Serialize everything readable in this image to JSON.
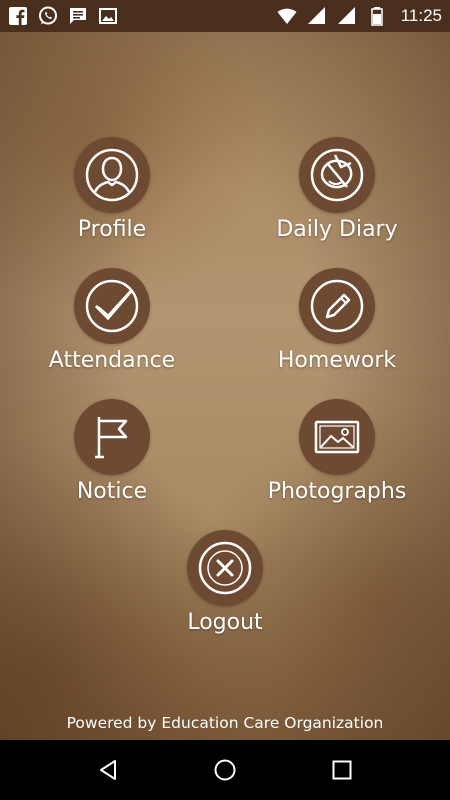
{
  "status_bar": {
    "time": "11:25",
    "left_icons": [
      "facebook-icon",
      "whatsapp-icon",
      "message-icon",
      "image-icon"
    ],
    "right_icons": [
      "wifi-icon",
      "signal-icon",
      "signal-icon",
      "battery-icon"
    ]
  },
  "menu": {
    "profile": {
      "label": "Profile",
      "icon": "user-icon"
    },
    "daily_diary": {
      "label": "Daily Diary",
      "icon": "diary-icon"
    },
    "attendance": {
      "label": "Attendance",
      "icon": "check-icon"
    },
    "homework": {
      "label": "Homework",
      "icon": "pencil-icon"
    },
    "notice": {
      "label": "Notice",
      "icon": "flag-icon"
    },
    "photographs": {
      "label": "Photographs",
      "icon": "photo-icon"
    },
    "logout": {
      "label": "Logout",
      "icon": "close-icon"
    }
  },
  "footer": {
    "text": "Powered by Education Care Organization"
  },
  "nav_bar": {
    "buttons": [
      "back-icon",
      "home-icon",
      "recents-icon"
    ]
  },
  "colors": {
    "status_bar": "#4a2f1f",
    "icon_circle": "#6e4a33",
    "text": "#ffffff"
  }
}
